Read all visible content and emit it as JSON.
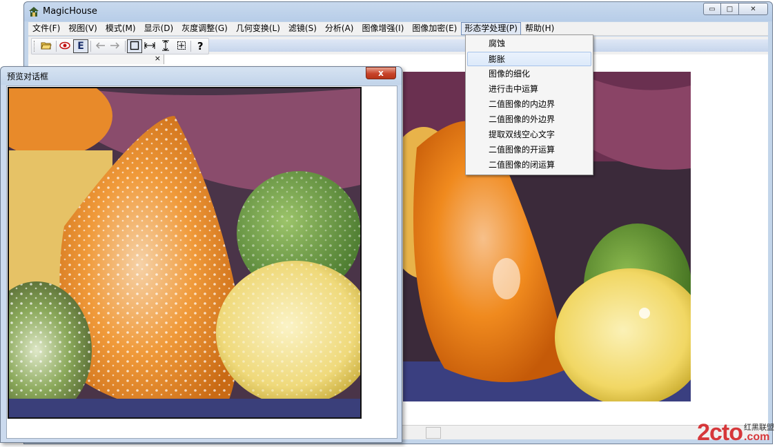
{
  "app": {
    "title": "MagicHouse"
  },
  "window_controls": {
    "minimize": "▭",
    "maximize": "□",
    "close": "✕"
  },
  "menubar": [
    {
      "label": "文件(F)"
    },
    {
      "label": "视图(V)"
    },
    {
      "label": "模式(M)"
    },
    {
      "label": "显示(D)"
    },
    {
      "label": "灰度调整(G)"
    },
    {
      "label": "几何变换(L)"
    },
    {
      "label": "滤镜(S)"
    },
    {
      "label": "分析(A)"
    },
    {
      "label": "图像增强(I)"
    },
    {
      "label": "图像加密(E)"
    },
    {
      "label": "形态学处理(P)",
      "active": true
    },
    {
      "label": "帮助(H)"
    }
  ],
  "toolbar": {
    "icons": [
      "open-folder-icon",
      "eye-icon",
      "edit-e-icon",
      "back-arrow-icon",
      "forward-arrow-icon",
      "select-rect-icon",
      "measure-horizontal-icon",
      "measure-vertical-icon",
      "crop-icon",
      "help-icon"
    ],
    "e_label": "E",
    "help_label": "?"
  },
  "client_bar": {
    "close": "×"
  },
  "dropdown": {
    "items": [
      "腐蚀",
      "膨胀",
      "图像的细化",
      "进行击中运算",
      "二值图像的内边界",
      "二值图像的外边界",
      "提取双线空心文字",
      "二值图像的开运算",
      "二值图像的闭运算"
    ],
    "hover_index": 1
  },
  "preview": {
    "title": "预览对话框",
    "close": "x"
  },
  "watermark": {
    "main": "2cto",
    "cn": "红黑联盟",
    "com": ".com"
  },
  "colors": {
    "accent": "#6f8cb8",
    "close_red": "#c7432a",
    "watermark_red": "#d6373a"
  }
}
